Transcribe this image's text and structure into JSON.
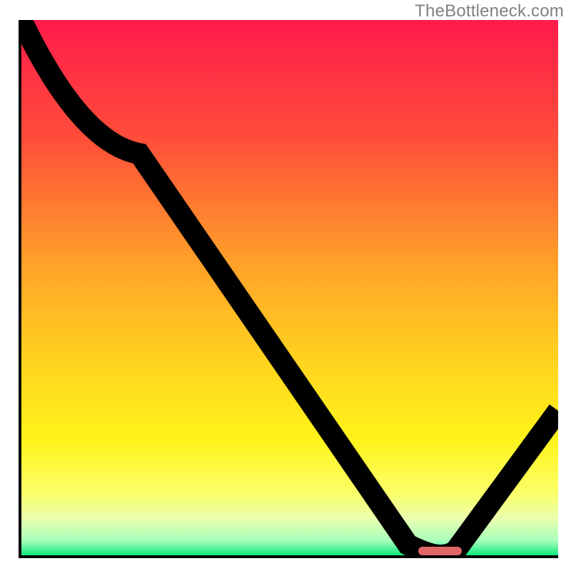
{
  "watermark": "TheBottleneck.com",
  "chart_data": {
    "type": "line",
    "title": "",
    "xlabel": "",
    "ylabel": "",
    "xlim": [
      0,
      100
    ],
    "ylim": [
      0,
      100
    ],
    "x": [
      0,
      22,
      72,
      76,
      80,
      100
    ],
    "values": [
      100,
      75,
      2,
      0,
      0,
      27
    ],
    "marker": {
      "x_start": 74,
      "x_end": 82,
      "y": 0
    },
    "gradient_stops": [
      {
        "p": 0.0,
        "c": "#ff1b4b"
      },
      {
        "p": 0.22,
        "c": "#ff4d3a"
      },
      {
        "p": 0.45,
        "c": "#ffa029"
      },
      {
        "p": 0.63,
        "c": "#ffd21f"
      },
      {
        "p": 0.78,
        "c": "#fff31a"
      },
      {
        "p": 0.88,
        "c": "#fbff66"
      },
      {
        "p": 0.93,
        "c": "#e8ffb0"
      },
      {
        "p": 0.97,
        "c": "#a8ffba"
      },
      {
        "p": 1.0,
        "c": "#00e676"
      }
    ]
  }
}
